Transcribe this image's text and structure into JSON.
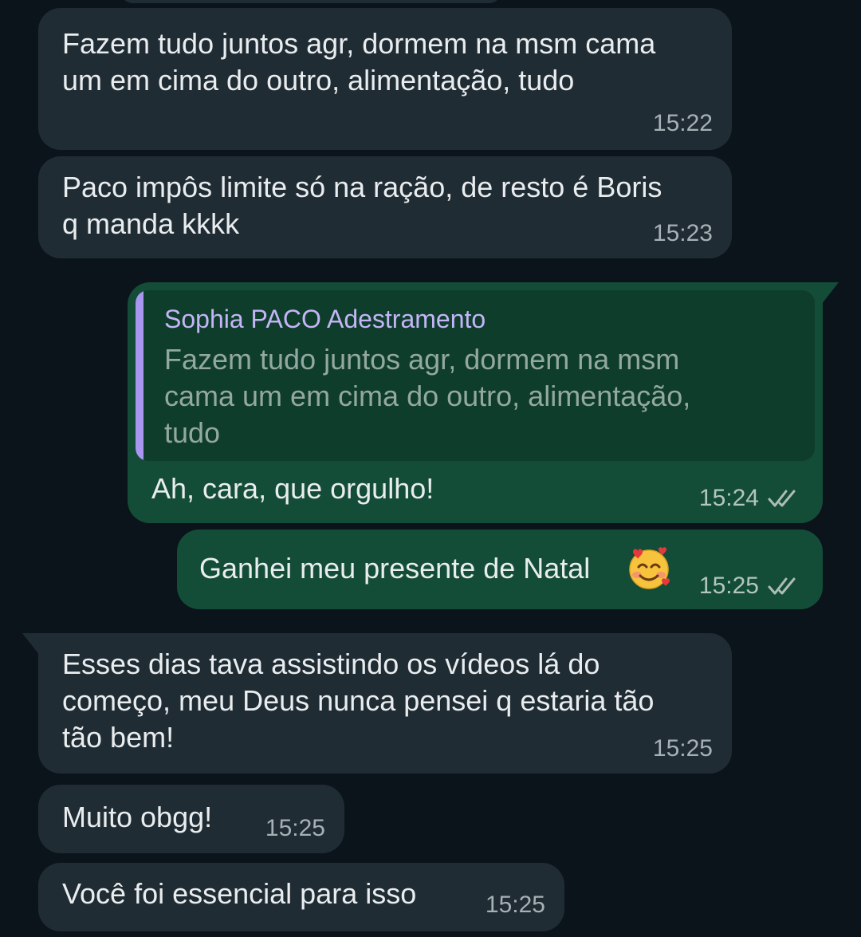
{
  "messages": [
    {
      "direction": "in",
      "text": "Fazem tudo juntos agr, dormem na msm cama\num em cima do outro, alimentação, tudo",
      "time": "15:22"
    },
    {
      "direction": "in",
      "text": "Paco impôs limite só na ração, de resto é Boris\nq manda kkkk",
      "time": "15:23"
    },
    {
      "direction": "out",
      "quote_author": "Sophia PACO Adestramento",
      "quote_text": "Fazem tudo juntos agr, dormem na msm\ncama um em cima do outro, alimentação,\ntudo",
      "text": "Ah, cara, que orgulho!",
      "time": "15:24",
      "status": "read"
    },
    {
      "direction": "out",
      "text": "Ganhei meu presente de Natal",
      "emoji": "smiling-face-with-hearts",
      "time": "15:25",
      "status": "read"
    },
    {
      "direction": "in",
      "text": "Esses dias tava assistindo os vídeos lá do\ncomeço, meu Deus nunca pensei q estaria tão\ntão bem!",
      "time": "15:25"
    },
    {
      "direction": "in",
      "text": "Muito obgg!",
      "time": "15:25"
    },
    {
      "direction": "in",
      "text": "Você foi essencial para isso",
      "time": "15:25"
    }
  ],
  "colors": {
    "background": "#0b141a",
    "incoming_bubble": "#202c33",
    "outgoing_bubble": "#144d37",
    "quote_accent": "#a896f0",
    "read_ticks": "#aebdb6"
  }
}
